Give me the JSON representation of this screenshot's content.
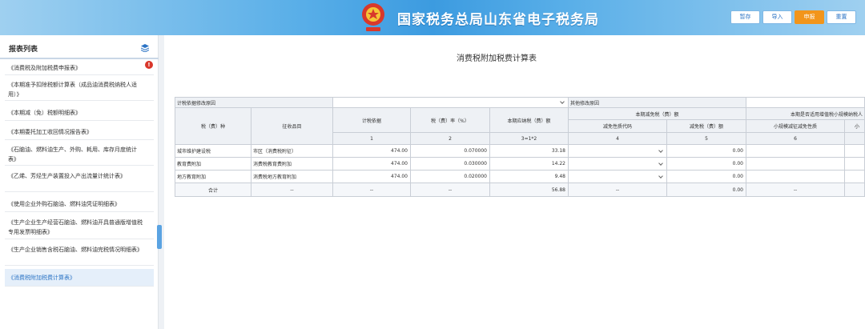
{
  "header": {
    "title": "国家税务总局山东省电子税务局",
    "buttons": [
      "暂存",
      "导入",
      "申报",
      "重置"
    ],
    "accent": "#f2951b"
  },
  "sidebar": {
    "title": "报表列表",
    "badge": "!",
    "items": [
      "《消费税及附加税费申报表》",
      "《本期准予扣除税额计算表（成品油消费税纳税人适用）》",
      "《本期减（免）税额明细表》",
      "《本期委托加工收回情况报告表》",
      "《石脑油、燃料油生产、外购、耗用、库存月度统计表》",
      "《乙烯、芳烃生产装置投入产出流量计统计表》",
      "《使用企业外购石脑油、燃料油凭证明细表》",
      "《生产企业生产经营石脑油、燃料油开具普通版增值税专用发票明细表》",
      "《生产企业销售含税石脑油、燃料油完税情况明细表》",
      "《消费税附加税费计算表》"
    ]
  },
  "main": {
    "report_title": "消费税附加税费计算表",
    "policy_basis_label": "计税依据修改原因",
    "other_reason_label": "其他修改原因",
    "headers": {
      "tax_type": "税（费）种",
      "item": "征收品目",
      "basis": "计税依据",
      "rate": "税（费）率（%）",
      "payable": "本期应纳税（费）额",
      "reduction_group": "本期减免税（费）额",
      "reduction_code": "减免性质代码",
      "reduction_amount": "减免税（费）额",
      "small_group": "本期是否适用增值税小规模纳税人",
      "small_code": "小规模减征减免性质",
      "small_amount": "小"
    },
    "index_row": [
      "1",
      "2",
      "3=1*2",
      "4",
      "5",
      "6"
    ],
    "rows": [
      {
        "tax": "城市维护建设税",
        "item": "市区（消费税附征）",
        "basis": "474.00",
        "rate": "0.070000",
        "payable": "33.18",
        "code": "",
        "reduction": "0.00"
      },
      {
        "tax": "教育费附加",
        "item": "消费税教育费附加",
        "basis": "474.00",
        "rate": "0.030000",
        "payable": "14.22",
        "code": "",
        "reduction": "0.00"
      },
      {
        "tax": "地方教育附加",
        "item": "消费税地方教育附加",
        "basis": "474.00",
        "rate": "0.020000",
        "payable": "9.48",
        "code": "",
        "reduction": "0.00"
      }
    ],
    "total": {
      "label": "合计",
      "item": "--",
      "basis": "--",
      "rate": "--",
      "payable": "56.88",
      "code": "--",
      "reduction": "0.00",
      "small_code": "--"
    }
  }
}
